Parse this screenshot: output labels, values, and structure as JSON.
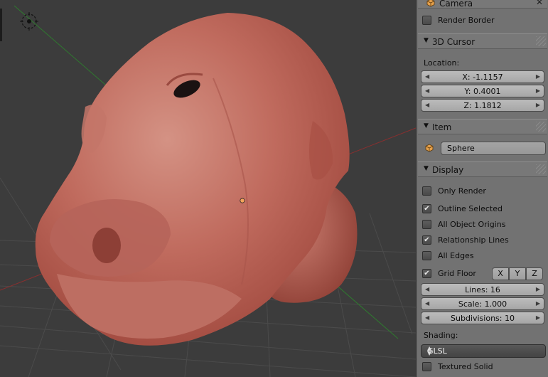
{
  "camera_panel": {
    "title": "Camera",
    "render_border_label": "Render Border",
    "render_border_checked": false
  },
  "cursor_panel": {
    "title": "3D Cursor",
    "location_label": "Location:",
    "x": "X: -1.1157",
    "y": "Y: 0.4001",
    "z": "Z: 1.1812"
  },
  "item_panel": {
    "title": "Item",
    "object_name": "Sphere"
  },
  "display_panel": {
    "title": "Display",
    "only_render": {
      "label": "Only Render",
      "checked": false
    },
    "outline_selected": {
      "label": "Outline Selected",
      "checked": true
    },
    "all_object_origins": {
      "label": "All Object Origins",
      "checked": false
    },
    "relationship_lines": {
      "label": "Relationship Lines",
      "checked": true
    },
    "all_edges": {
      "label": "All Edges",
      "checked": false
    },
    "grid_floor": {
      "label": "Grid Floor",
      "checked": true
    },
    "axis_x": "X",
    "axis_y": "Y",
    "axis_z": "Z",
    "lines": "Lines: 16",
    "scale": "Scale: 1.000",
    "subdivisions": "Subdivisions: 10",
    "shading_label": "Shading:",
    "shading_value": "GLSL",
    "textured_solid": {
      "label": "Textured Solid",
      "checked": false
    }
  },
  "colors": {
    "panel_bg": "#727272",
    "viewport_bg": "#3c3c3c",
    "mesh": "#b4574c",
    "x_axis": "#8a2f2f",
    "y_axis": "#2f7a2f"
  },
  "icons": [
    "camera-cube-icon",
    "close-x-icon",
    "object-cube-icon",
    "scene-origin-icon",
    "check-icon",
    "disclosure-triangle-icon"
  ]
}
